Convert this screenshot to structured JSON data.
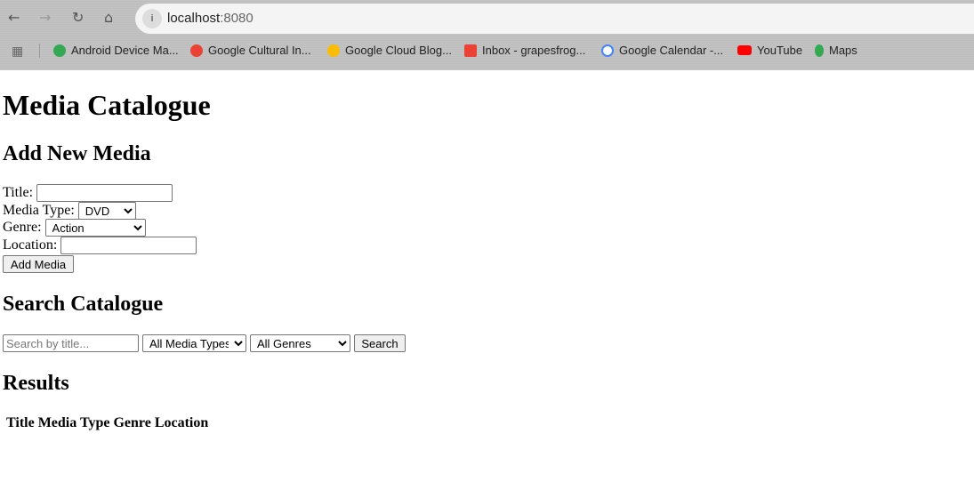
{
  "browser": {
    "url_host": "localhost",
    "url_port": ":8080",
    "bookmarks": [
      {
        "label": "Android Device Ma...",
        "color": "#34a853"
      },
      {
        "label": "Google Cultural In...",
        "color": "#ea4335"
      },
      {
        "label": "Google Cloud Blog...",
        "color": "#4285f4"
      },
      {
        "label": "Inbox - grapesfrog...",
        "color": "#ea4335"
      },
      {
        "label": "Google Calendar -...",
        "color": "#4285f4"
      },
      {
        "label": "YouTube",
        "color": "#ff0000"
      },
      {
        "label": "Maps",
        "color": "#34a853"
      }
    ]
  },
  "page": {
    "title": "Media Catalogue",
    "add": {
      "heading": "Add New Media",
      "title_label": "Title:",
      "title_value": "",
      "type_label": "Media Type:",
      "type_value": "DVD",
      "genre_label": "Genre:",
      "genre_value": "Action",
      "location_label": "Location:",
      "location_value": "",
      "submit": "Add Media"
    },
    "search": {
      "heading": "Search Catalogue",
      "placeholder": "Search by title...",
      "type_value": "All Media Types",
      "genre_value": "All Genres",
      "submit": "Search"
    },
    "results": {
      "heading": "Results",
      "columns": [
        "Title",
        "Media Type",
        "Genre",
        "Location"
      ]
    }
  }
}
